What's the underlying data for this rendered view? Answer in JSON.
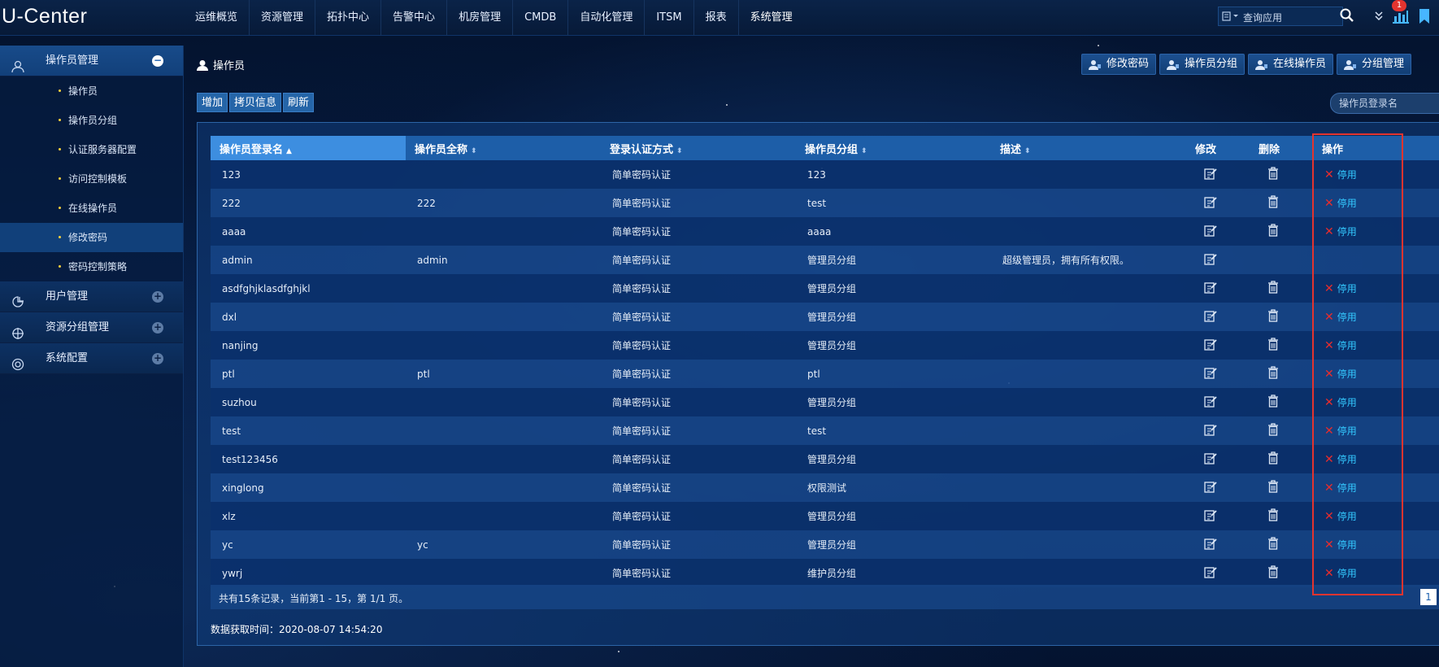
{
  "app": {
    "logo": "U-Center"
  },
  "nav": {
    "items": [
      "运维概览",
      "资源管理",
      "拓扑中心",
      "告警中心",
      "机房管理",
      "CMDB",
      "自动化管理",
      "ITSM",
      "报表",
      "系统管理"
    ]
  },
  "header": {
    "search_type_icon": "app-filter-icon",
    "search_placeholder": "查询应用",
    "notification_count": "1"
  },
  "sidebar": {
    "groups": [
      {
        "label": "操作员管理",
        "open": true,
        "items": [
          "操作员",
          "操作员分组",
          "认证服务器配置",
          "访问控制模板",
          "在线操作员",
          "修改密码",
          "密码控制策略"
        ],
        "active_item": 5
      },
      {
        "label": "用户管理",
        "open": false
      },
      {
        "label": "资源分组管理",
        "open": false
      },
      {
        "label": "系统配置",
        "open": false
      }
    ]
  },
  "page": {
    "title": "操作员",
    "quick_buttons": [
      "修改密码",
      "操作员分组",
      "在线操作员",
      "分组管理"
    ],
    "actions": [
      "增加",
      "拷贝信息",
      "刷新"
    ],
    "filter_placeholder": "操作员登录名"
  },
  "table": {
    "columns": [
      "操作员登录名",
      "操作员全称",
      "登录认证方式",
      "操作员分组",
      "描述",
      "修改",
      "删除",
      "操作"
    ],
    "sorted_column": 0,
    "rows": [
      {
        "login": "123",
        "fullname": "",
        "auth": "简单密码认证",
        "group": "123",
        "desc": "",
        "deletable": true,
        "op": "停用"
      },
      {
        "login": "222",
        "fullname": "222",
        "auth": "简单密码认证",
        "group": "test",
        "desc": "",
        "deletable": true,
        "op": "停用"
      },
      {
        "login": "aaaa",
        "fullname": "",
        "auth": "简单密码认证",
        "group": "aaaa",
        "desc": "",
        "deletable": true,
        "op": "停用"
      },
      {
        "login": "admin",
        "fullname": "admin",
        "auth": "简单密码认证",
        "group": "管理员分组",
        "desc": "超级管理员，拥有所有权限。",
        "deletable": false,
        "op": ""
      },
      {
        "login": "asdfghjklasdfghjkl",
        "fullname": "",
        "auth": "简单密码认证",
        "group": "管理员分组",
        "desc": "",
        "deletable": true,
        "op": "停用"
      },
      {
        "login": "dxl",
        "fullname": "",
        "auth": "简单密码认证",
        "group": "管理员分组",
        "desc": "",
        "deletable": true,
        "op": "停用"
      },
      {
        "login": "nanjing",
        "fullname": "",
        "auth": "简单密码认证",
        "group": "管理员分组",
        "desc": "",
        "deletable": true,
        "op": "停用"
      },
      {
        "login": "ptl",
        "fullname": "ptl",
        "auth": "简单密码认证",
        "group": "ptl",
        "desc": "",
        "deletable": true,
        "op": "停用"
      },
      {
        "login": "suzhou",
        "fullname": "",
        "auth": "简单密码认证",
        "group": "管理员分组",
        "desc": "",
        "deletable": true,
        "op": "停用"
      },
      {
        "login": "test",
        "fullname": "",
        "auth": "简单密码认证",
        "group": "test",
        "desc": "",
        "deletable": true,
        "op": "停用"
      },
      {
        "login": "test123456",
        "fullname": "",
        "auth": "简单密码认证",
        "group": "管理员分组",
        "desc": "",
        "deletable": true,
        "op": "停用"
      },
      {
        "login": "xinglong",
        "fullname": "",
        "auth": "简单密码认证",
        "group": "权限测试",
        "desc": "",
        "deletable": true,
        "op": "停用"
      },
      {
        "login": "xlz",
        "fullname": "",
        "auth": "简单密码认证",
        "group": "管理员分组",
        "desc": "",
        "deletable": true,
        "op": "停用"
      },
      {
        "login": "yc",
        "fullname": "yc",
        "auth": "简单密码认证",
        "group": "管理员分组",
        "desc": "",
        "deletable": true,
        "op": "停用"
      },
      {
        "login": "ywrj",
        "fullname": "",
        "auth": "简单密码认证",
        "group": "维护员分组",
        "desc": "",
        "deletable": true,
        "op": "停用"
      }
    ],
    "footer": "共有15条记录，当前第1 - 15，第 1/1 页。",
    "current_page": "1",
    "fetch_time": "数据获取时间：2020-08-07 14:54:20"
  },
  "colors": {
    "accent": "#1d5ea8",
    "link": "#33c9ff",
    "danger": "#e82c2c",
    "highlight": "#e3342f"
  }
}
